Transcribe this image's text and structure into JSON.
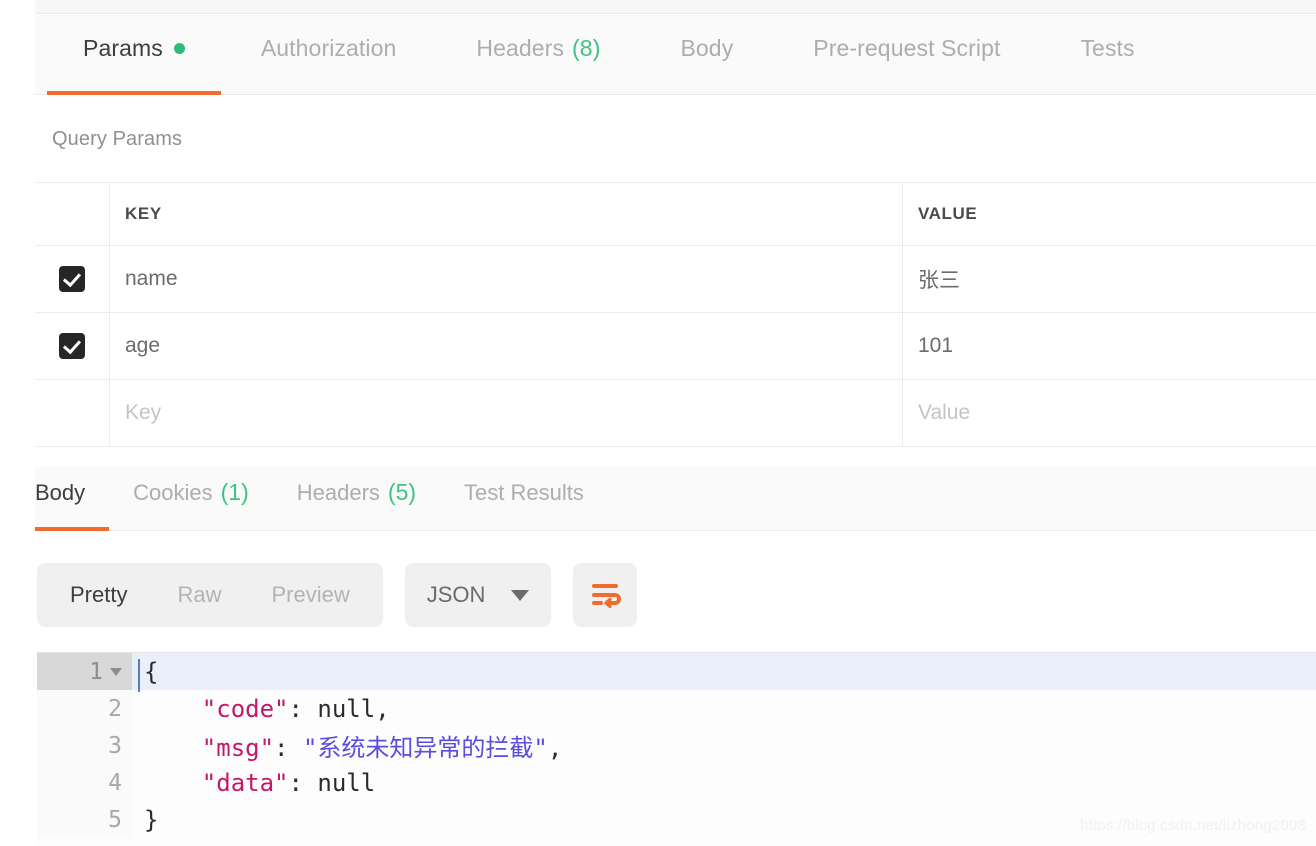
{
  "request_tabs": [
    {
      "label": "Params",
      "active": true,
      "dot": true,
      "count": ""
    },
    {
      "label": "Authorization",
      "active": false,
      "dot": false,
      "count": ""
    },
    {
      "label": "Headers",
      "active": false,
      "dot": false,
      "count": "(8)"
    },
    {
      "label": "Body",
      "active": false,
      "dot": false,
      "count": ""
    },
    {
      "label": "Pre-request Script",
      "active": false,
      "dot": false,
      "count": ""
    },
    {
      "label": "Tests",
      "active": false,
      "dot": false,
      "count": ""
    }
  ],
  "params_section": {
    "title": "Query Params",
    "columns": {
      "key": "KEY",
      "value": "VALUE"
    },
    "rows": [
      {
        "checked": true,
        "key": "name",
        "value": "张三",
        "key_placeholder": "",
        "value_placeholder": ""
      },
      {
        "checked": true,
        "key": "age",
        "value": "101",
        "key_placeholder": "",
        "value_placeholder": ""
      },
      {
        "checked": false,
        "key": "",
        "value": "",
        "key_placeholder": "Key",
        "value_placeholder": "Value"
      }
    ]
  },
  "response_tabs": [
    {
      "label": "Body",
      "active": true,
      "count": ""
    },
    {
      "label": "Cookies",
      "active": false,
      "count": "(1)"
    },
    {
      "label": "Headers",
      "active": false,
      "count": "(5)"
    },
    {
      "label": "Test Results",
      "active": false,
      "count": ""
    }
  ],
  "body_toolbar": {
    "view_modes": [
      {
        "label": "Pretty",
        "active": true
      },
      {
        "label": "Raw",
        "active": false
      },
      {
        "label": "Preview",
        "active": false
      }
    ],
    "format_selected": "JSON",
    "wrap_icon": "wrap-lines-icon"
  },
  "response_body": {
    "language": "json",
    "lines": [
      {
        "num": "1",
        "foldable": true,
        "active": true,
        "tokens": [
          {
            "t": "punc",
            "v": "{"
          }
        ]
      },
      {
        "num": "2",
        "foldable": false,
        "active": false,
        "tokens": [
          {
            "t": "plain",
            "v": "    "
          },
          {
            "t": "key",
            "v": "\"code\""
          },
          {
            "t": "punc",
            "v": ": "
          },
          {
            "t": "lit",
            "v": "null,"
          }
        ]
      },
      {
        "num": "3",
        "foldable": false,
        "active": false,
        "tokens": [
          {
            "t": "plain",
            "v": "    "
          },
          {
            "t": "key",
            "v": "\"msg\""
          },
          {
            "t": "punc",
            "v": ": "
          },
          {
            "t": "str",
            "v": "\"系统未知异常的拦截\""
          },
          {
            "t": "punc",
            "v": ","
          }
        ]
      },
      {
        "num": "4",
        "foldable": false,
        "active": false,
        "tokens": [
          {
            "t": "plain",
            "v": "    "
          },
          {
            "t": "key",
            "v": "\"data\""
          },
          {
            "t": "punc",
            "v": ": "
          },
          {
            "t": "lit",
            "v": "null"
          }
        ]
      },
      {
        "num": "5",
        "foldable": false,
        "active": false,
        "tokens": [
          {
            "t": "punc",
            "v": "}"
          }
        ]
      }
    ],
    "raw_text": "{\n    \"code\": null,\n    \"msg\": \"系统未知异常的拦截\",\n    \"data\": null\n}"
  },
  "watermark": {
    "text": "https://blog.csdn.net/lizhong2008"
  },
  "colors": {
    "accent_orange": "#ef6c2e",
    "status_green": "#2fb97b",
    "count_green": "#3fc380",
    "json_key": "#c2186b",
    "json_string": "#5b4ce0",
    "checkbox_fill": "#262626",
    "active_line": "#eaf0fb"
  }
}
